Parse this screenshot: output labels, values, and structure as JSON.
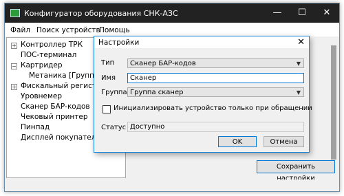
{
  "window": {
    "title": "Конфигуратор оборудования СНК-АЗС",
    "minimize_glyph": "—",
    "maximize_glyph": "☐",
    "close_glyph": "✕"
  },
  "menu": [
    "Файл",
    "Поиск устройств",
    "Помощь"
  ],
  "tree": {
    "items": [
      {
        "label": "Контроллер ТРК",
        "expander": "+"
      },
      {
        "label": "ПОС-терминал",
        "expander": ""
      },
      {
        "label": "Картридер",
        "expander": "−"
      },
      {
        "label": "Метаника [Группа с",
        "expander": ""
      },
      {
        "label": "Фискальный регистрат",
        "expander": "+"
      },
      {
        "label": "Уровнемер",
        "expander": ""
      },
      {
        "label": "Сканер БАР-кодов",
        "expander": ""
      },
      {
        "label": "Чековый принтер",
        "expander": ""
      },
      {
        "label": "Пинпад",
        "expander": ""
      },
      {
        "label": "Дисплей покупателя",
        "expander": ""
      }
    ]
  },
  "save_button": "Сохранить настройки",
  "dialog": {
    "title": "Настройки",
    "close_glyph": "✕",
    "type_label": "Тип",
    "type_value": "Сканер БАР-кодов",
    "name_label": "Имя",
    "name_value": "Сканер",
    "group_label": "Группа",
    "group_value": "Группа сканер",
    "init_checkbox_label": "Инициализировать устройство только при обращении",
    "status_label": "Статус",
    "status_value": "Доступно",
    "ok_label": "OK",
    "cancel_label": "Отмена"
  }
}
